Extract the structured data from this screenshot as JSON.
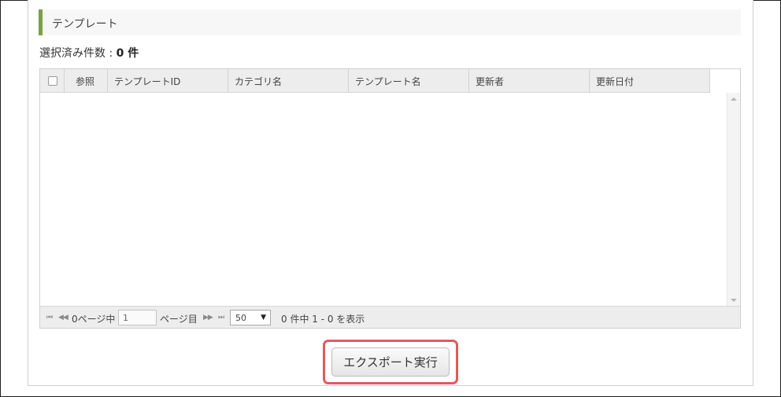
{
  "section": {
    "title": "テンプレート"
  },
  "selection": {
    "label": "選択済み件数 : ",
    "count": "0 件"
  },
  "grid": {
    "columns": [
      "参照",
      "テンプレートID",
      "カテゴリ名",
      "テンプレート名",
      "更新者",
      "更新日付"
    ]
  },
  "pager": {
    "total_pages_text": "0ページ中",
    "current_page": "1",
    "page_suffix": "ページ目",
    "page_size": "50",
    "summary": "0 件中 1 - 0 を表示"
  },
  "actions": {
    "export_label": "エクスポート実行"
  },
  "colors": {
    "accent": "#7ba23f",
    "highlight": "#e05a5f"
  }
}
